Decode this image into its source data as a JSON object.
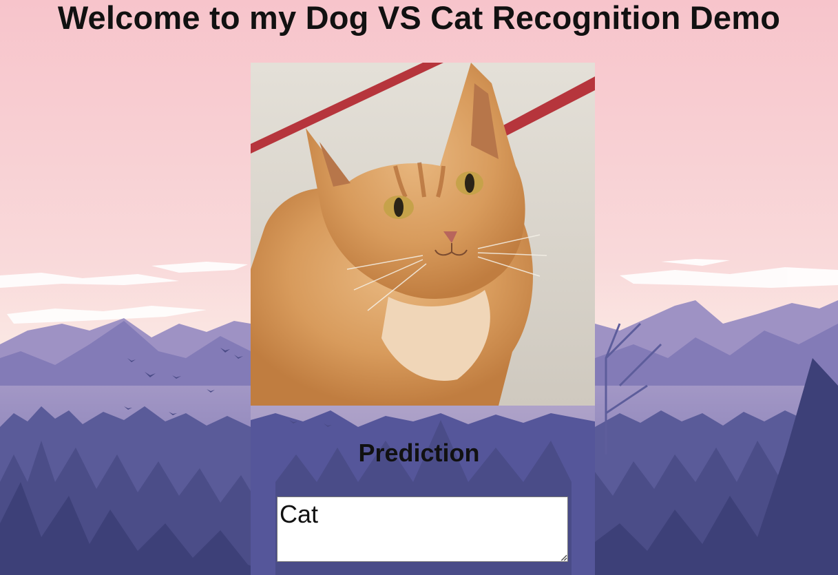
{
  "page": {
    "title": "Welcome to my Dog VS Cat Recognition Demo"
  },
  "image": {
    "subject": "orange tabby cat"
  },
  "prediction": {
    "heading": "Prediction",
    "value": "Cat"
  },
  "colors": {
    "sky_top": "#f6c6cc",
    "mountain_far": "#8f86bb",
    "mountain_mid": "#6e6aa8",
    "forest": "#484a83",
    "forest_dark": "#33386a",
    "title_text": "#111111"
  }
}
